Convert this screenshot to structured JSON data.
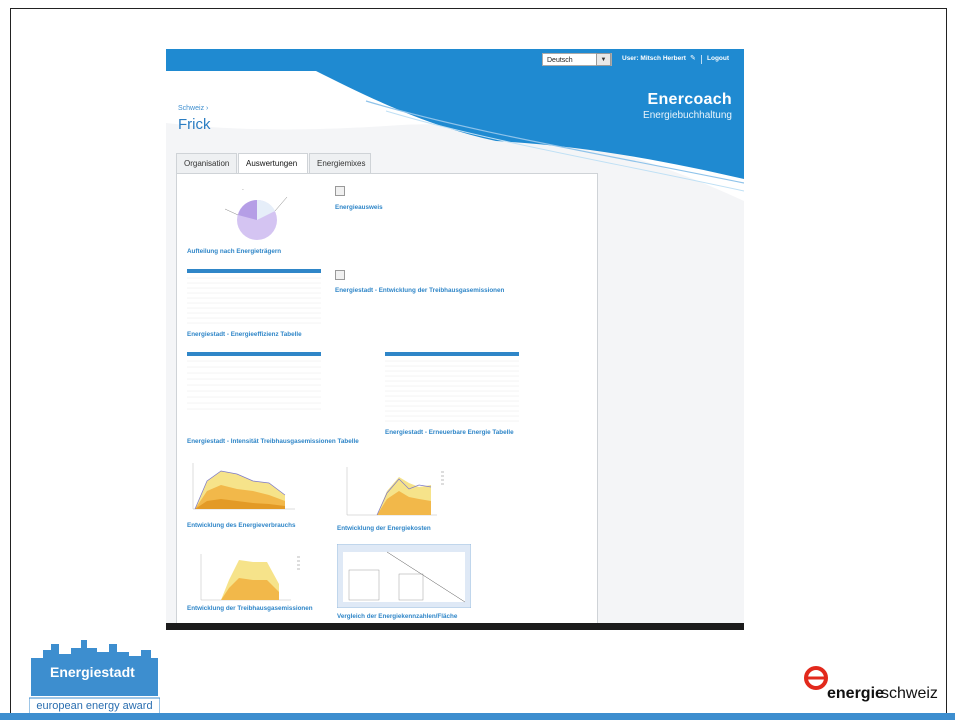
{
  "header": {
    "language": "Deutsch",
    "user_label": "User: Mitsch Herbert",
    "logout": "Logout",
    "brand_title": "Enercoach",
    "brand_subtitle": "Energiebuchhaltung"
  },
  "breadcrumb": "Schweiz ›",
  "page_title": "Frick",
  "tabs": [
    {
      "label": "Organisation"
    },
    {
      "label": "Auswertungen"
    },
    {
      "label": "Energiemixes"
    }
  ],
  "reports": [
    {
      "label": "Aufteilung nach Energieträgern"
    },
    {
      "label": "Energieausweis"
    },
    {
      "label": "Energiestadt - Entwicklung der Treibhausgasemissionen"
    },
    {
      "label": "Energiestadt - Energieeffizienz Tabelle"
    },
    {
      "label": "Energiestadt - Intensität Treibhausgasemissionen Tabelle"
    },
    {
      "label": "Energiestadt - Erneuerbare Energie Tabelle"
    },
    {
      "label": "Entwicklung des Energieverbrauchs"
    },
    {
      "label": "Entwicklung der Energiekosten"
    },
    {
      "label": "Entwicklung der Treibhausgasemissionen"
    },
    {
      "label": "Vergleich der Energiekennzahlen/Fläche"
    }
  ],
  "logos": {
    "energiestadt": "Energiestadt",
    "eea": "european energy award",
    "ech_bold": "energie",
    "ech_regular": "schweiz"
  },
  "colors": {
    "accent": "#1f8ad1",
    "link": "#2f86c8"
  }
}
